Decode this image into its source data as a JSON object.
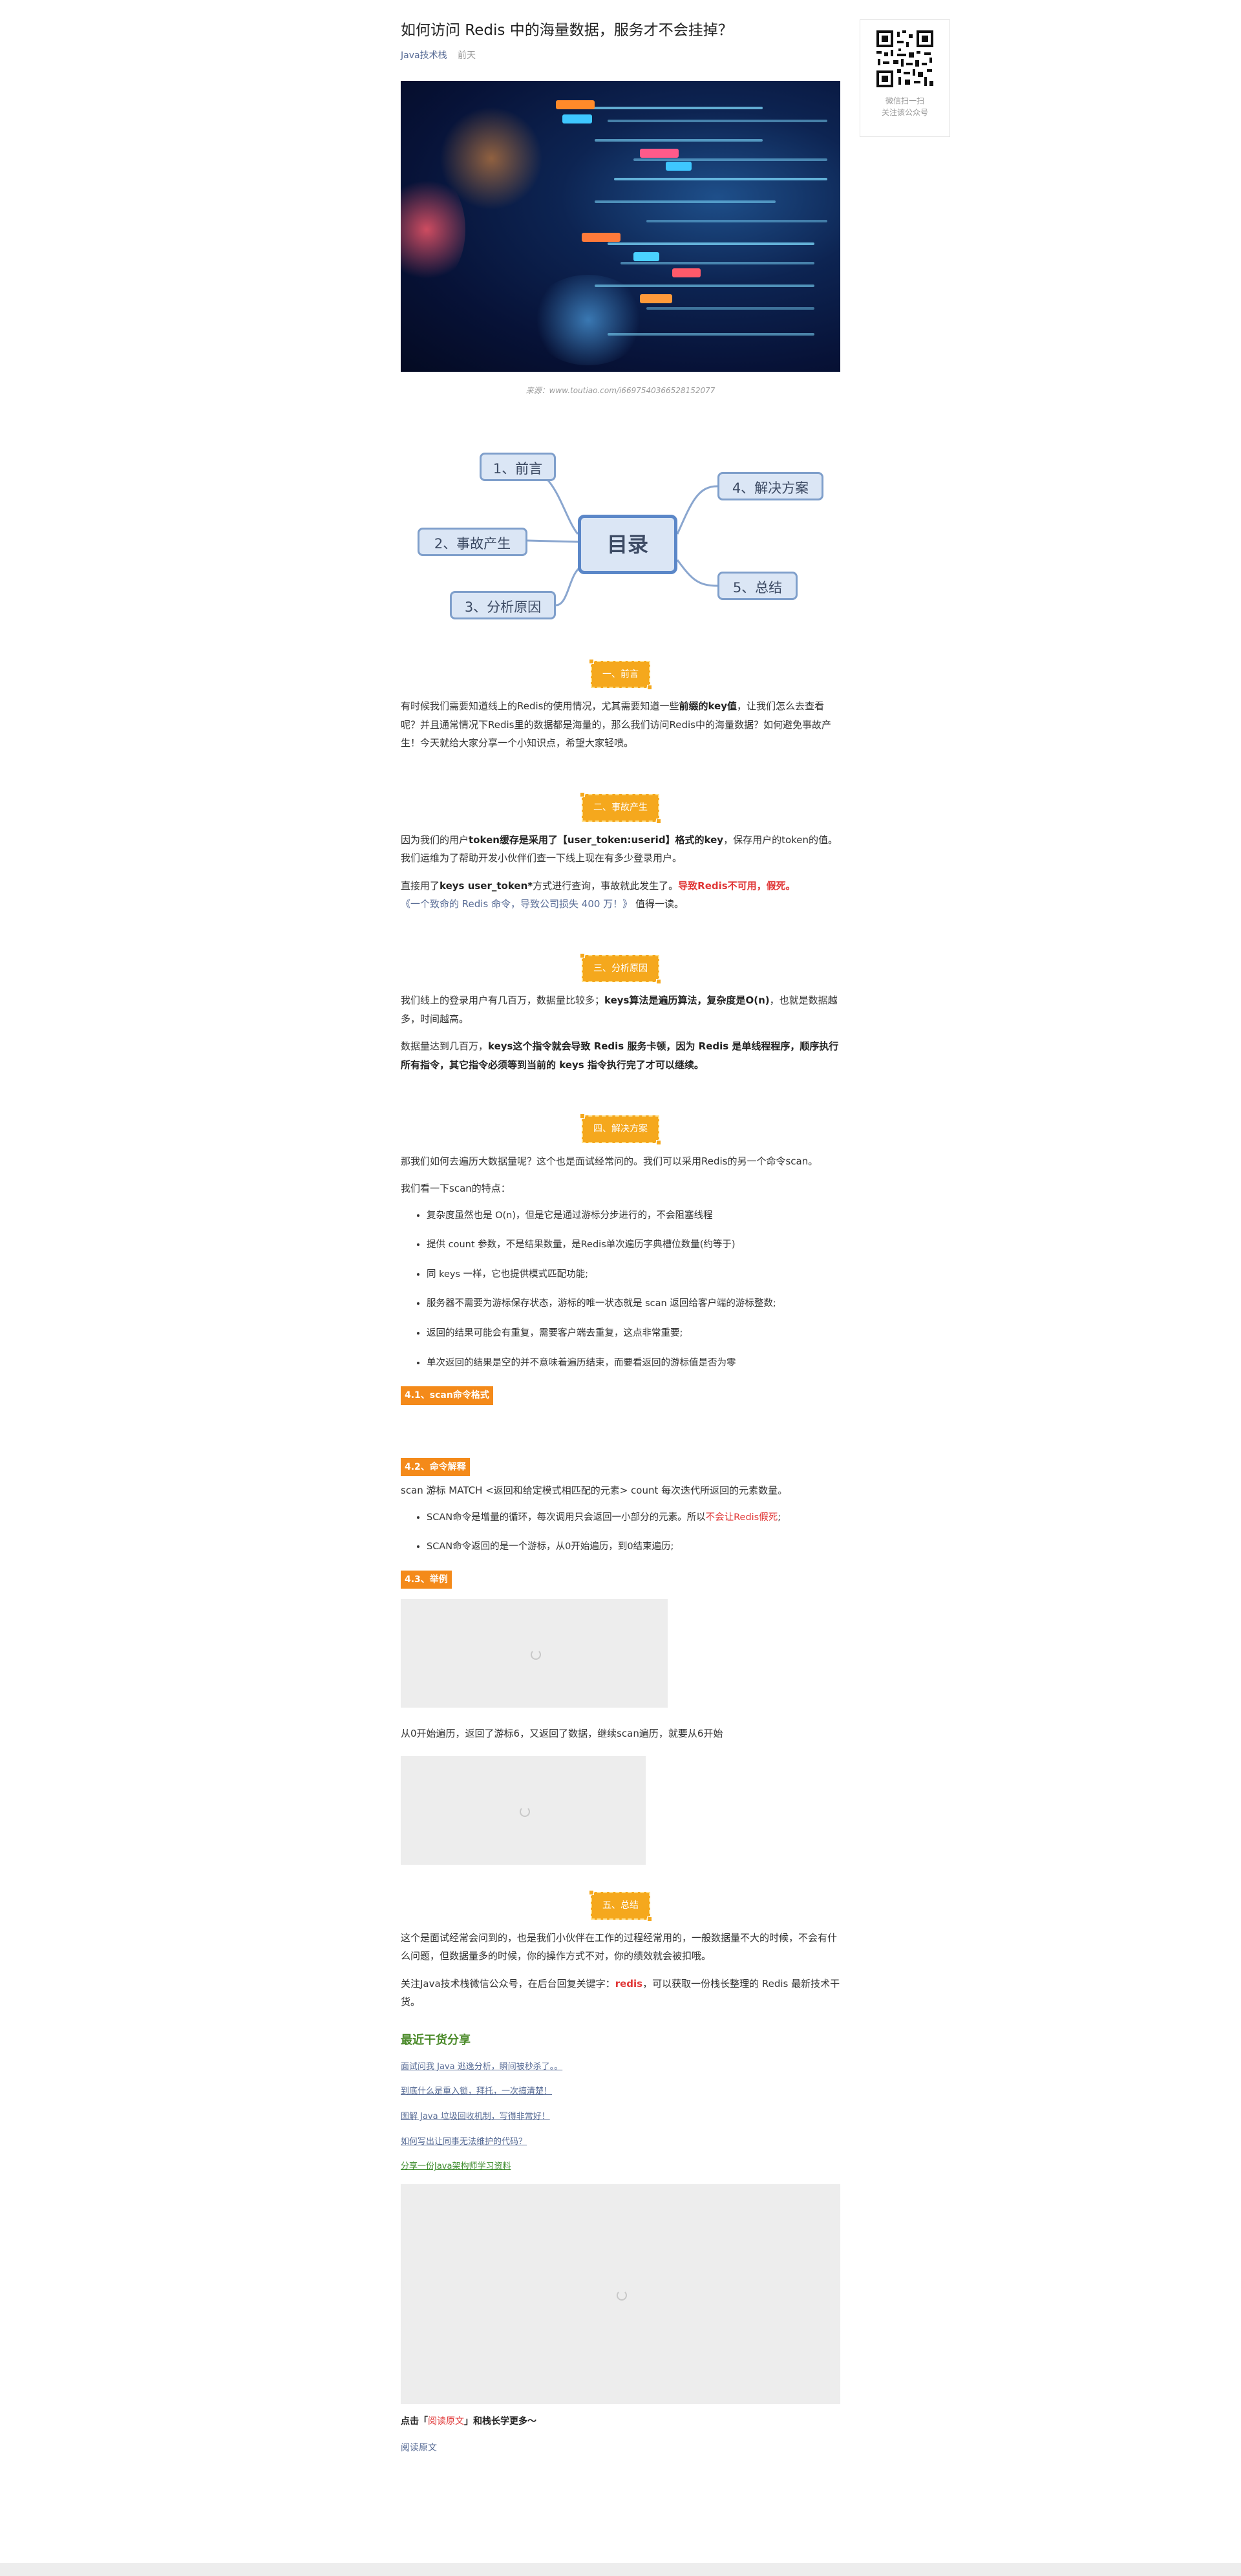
{
  "article": {
    "title": "如何访问 Redis 中的海量数据，服务才不会挂掉？",
    "author": "Java技术栈",
    "time": "前天",
    "hero_caption": "来源：www.toutiao.com/i6697540366528152077",
    "toc": {
      "center": "目录",
      "items": [
        "1、前言",
        "2、事故产生",
        "3、分析原因",
        "4、解决方案",
        "5、总结"
      ]
    },
    "sections": {
      "s1": {
        "heading": "一、前言",
        "p1a": "有时候我们需要知道线上的Redis的使用情况，尤其需要知道一些",
        "p1b": "前缀的key值",
        "p1c": "，让我们怎么去查看呢？并且通常情况下Redis里的数据都是海量的，那么我们访问Redis中的海量数据？如何避免事故产生！今天就给大家分享一个小知识点，希望大家轻喷。"
      },
      "s2": {
        "heading": "二、事故产生",
        "p1a": "因为我们的用户",
        "p1b": "token缓存是采用了【user_token:userid】格式的key",
        "p1c": "，保存用户的token的值。我们运维为了帮助开发小伙伴们查一下线上现在有多少登录用户。",
        "p2a": "直接用了",
        "p2b": "keys user_token*",
        "p2c": "方式进行查询，事故就此发生了。",
        "p2d": "导致Redis不可用，假死。",
        "p2e": "《一个致命的 Redis 命令，导致公司损失 400 万！》",
        "p2f": "值得一读。"
      },
      "s3": {
        "heading": "三、分析原因",
        "p1a": "我们线上的登录用户有几百万，数据量比较多；",
        "p1b": "keys算法是遍历算法，复杂度是O(n)",
        "p1c": "，也就是数据越多，时间越高。",
        "p2a": "数据量达到几百万，",
        "p2b": "keys这个指令就会导致 Redis 服务卡顿，因为 Redis 是单线程程序，顺序执行所有指令，其它指令必须等到当前的 keys 指令执行完了才可以继续。"
      },
      "s4": {
        "heading": "四、解决方案",
        "p1": "那我们如何去遍历大数据量呢？这个也是面试经常问的。我们可以采用Redis的另一个命令scan。",
        "p2": "我们看一下scan的特点：",
        "bullets": [
          "复杂度虽然也是 O(n)，但是它是通过游标分步进行的，不会阻塞线程",
          "提供 count 参数，不是结果数量，是Redis单次遍历字典槽位数量(约等于)",
          "同 keys 一样，它也提供模式匹配功能;",
          "服务器不需要为游标保存状态，游标的唯一状态就是 scan 返回给客户端的游标整数;",
          "返回的结果可能会有重复，需要客户端去重复，这点非常重要;",
          "单次返回的结果是空的并不意味着遍历结束，而要看返回的游标值是否为零"
        ],
        "sub1": "4.1、scan命令格式",
        "sub2": "4.2、命令解释",
        "cmd": "scan 游标 MATCH <返回和给定模式相匹配的元素> count 每次迭代所返回的元素数量。",
        "bullets2": [
          "SCAN命令是增量的循环，每次调用只会返回一小部分的元素。所以不会让Redis假死;",
          "SCAN命令返回的是一个游标，从0开始遍历，到0结束遍历;"
        ],
        "bullets2_red": "不会让Redis假死",
        "sub3": "4.3、举例",
        "after_img": "从0开始遍历，返回了游标6，又返回了数据，继续scan遍历，就要从6开始"
      },
      "s5": {
        "heading": "五、总结",
        "p1": "这个是面试经常会问到的，也是我们小伙伴在工作的过程经常用的，一般数据量不大的时候，不会有什么问题，但数据量多的时候，你的操作方式不对，你的绩效就会被扣哦。",
        "p2a": "关注Java技术栈微信公众号，在后台回复关键字：",
        "p2b": "redis",
        "p2c": "，可以获取一份栈长整理的 Redis 最新技术干货。"
      }
    },
    "recent": {
      "title": "最近干货分享",
      "links": [
        "面试问我 Java 逃逸分析，瞬间被秒杀了。。",
        "到底什么是重入锁，拜托，一次搞清楚！",
        "图解 Java 垃圾回收机制，写得非常好！",
        "如何写出让同事无法维护的代码？",
        "分享一份Java架构师学习资料"
      ]
    },
    "footer": {
      "prefix": "点击「",
      "highlight": "阅读原文",
      "suffix": "」和栈长学更多～",
      "read_more": "阅读原文"
    }
  },
  "qr": {
    "line1": "微信扫一扫",
    "line2": "关注该公众号"
  },
  "colors": {
    "accent_orange": "#f5a81d",
    "sub_orange": "#f48a1a",
    "link_blue": "#576b95",
    "red": "#e03636",
    "green": "#4b8a2a"
  }
}
